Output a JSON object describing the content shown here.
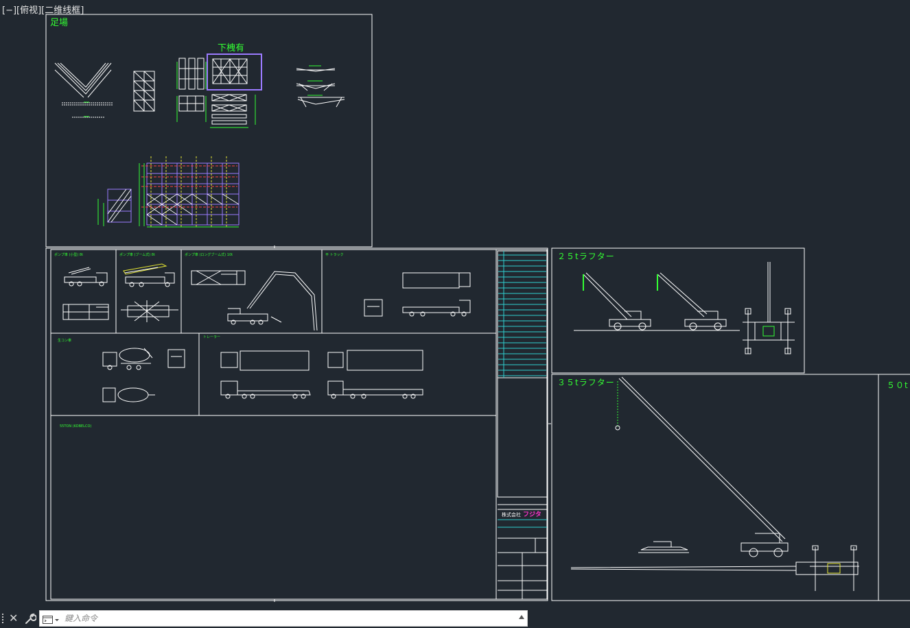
{
  "viewport": {
    "label": "[−][俯视][二维线框]"
  },
  "drawing": {
    "sheet_scaffold": {
      "title": "足場",
      "sub_label": "下栧有"
    },
    "sheet_pumps": {
      "cell_pump1": "ポンプ車 (小型)  8t",
      "cell_pump2": "ポンプ車 (ブーム式)  8t",
      "cell_pump3": "ポンプ車 (ロングブーム式)  10t",
      "cell_truck": "平 トラック",
      "cell_mixer": "生コン車",
      "cell_trailer": "トレーラー",
      "cell_crawler": "55TON (KOBELCO)",
      "company_name": "株式会社",
      "company_brand": "フジタ"
    },
    "sheet_25t": {
      "title": "２５tラフター"
    },
    "sheet_35t": {
      "title": "３５tラフター"
    },
    "sheet_50t": {
      "title": "５０t"
    }
  },
  "command_line": {
    "close_glyph": "✕",
    "placeholder": "鍵入命令"
  },
  "colors": {
    "background": "#212830",
    "frame": "#ffffff",
    "label_green": "#33ff33",
    "highlight_purple": "#9b7bff",
    "table_cyan": "#2fd0d0",
    "brand_magenta": "#ff33cc",
    "yellow": "#e6e633",
    "red": "#ff4040"
  }
}
